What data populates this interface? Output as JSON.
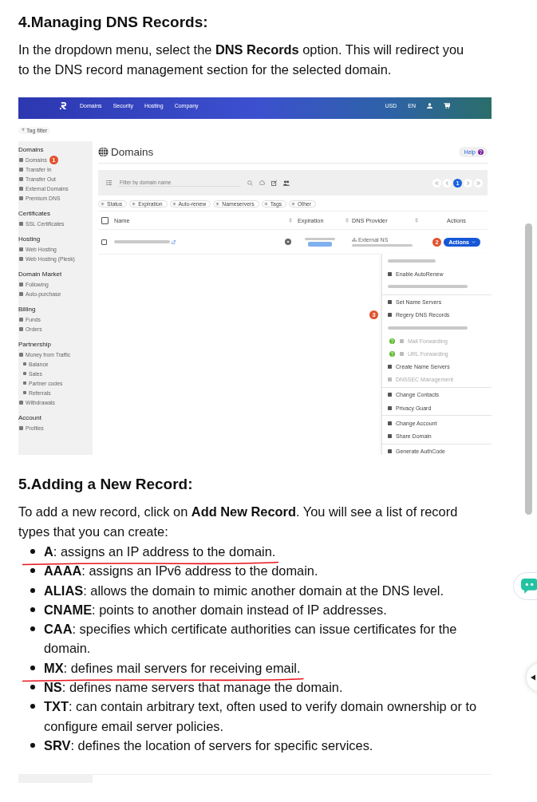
{
  "section_4": {
    "heading": "4.Managing DNS Records:",
    "paragraph": "In the dropdown menu, select the **DNS Records** option. This will redirect you to the DNS record management section for the selected domain."
  },
  "screenshot": {
    "nav": {
      "links": [
        "Domains",
        "Security",
        "Hosting",
        "Company"
      ],
      "currency": "USD",
      "language": "EN"
    },
    "tag_filter": "Tag filter",
    "sidebar": [
      {
        "heading": "Domains",
        "items": [
          {
            "label": "Domains",
            "badge": "1"
          },
          {
            "label": "Transfer In"
          },
          {
            "label": "Transfer Out"
          },
          {
            "label": "External Domains"
          },
          {
            "label": "Premium DNS"
          }
        ]
      },
      {
        "heading": "Certificates",
        "items": [
          {
            "label": "SSL Certificates"
          }
        ]
      },
      {
        "heading": "Hosting",
        "items": [
          {
            "label": "Web Hosting"
          },
          {
            "label": "Web Hosting (Plesk)"
          }
        ]
      },
      {
        "heading": "Domain Market",
        "items": [
          {
            "label": "Following"
          },
          {
            "label": "Auto-purchase"
          }
        ]
      },
      {
        "heading": "Billing",
        "items": [
          {
            "label": "Funds"
          },
          {
            "label": "Orders"
          }
        ]
      },
      {
        "heading": "Partnership",
        "items": [
          {
            "label": "Money from Traffic",
            "children": [
              {
                "label": "Balance"
              },
              {
                "label": "Sales"
              },
              {
                "label": "Partner codes"
              },
              {
                "label": "Referrals"
              }
            ]
          },
          {
            "label": "Withdrawals"
          }
        ]
      },
      {
        "heading": "Account",
        "items": [
          {
            "label": "Profiles"
          }
        ]
      }
    ],
    "title": "Domains",
    "help": "Help",
    "filter": {
      "placeholder": "Filter by domain name"
    },
    "pagination": [
      {
        "label": "1",
        "selected": true
      }
    ],
    "chips": [
      "Status",
      "Expiration",
      "Auto-renew",
      "Nameservers",
      "Tags",
      "Other"
    ],
    "columns": [
      "Name",
      "Expiration",
      "DNS Provider",
      "Actions"
    ],
    "select_all": {
      "checked": false
    },
    "row": {
      "checked": false,
      "provider": "External NS",
      "badge": "2",
      "action": "Actions"
    },
    "menu_groups": [
      [
        {
          "kind": "blurred"
        },
        {
          "kind": "item",
          "label": "Enable AutoRenew",
          "disabled": false,
          "help": false
        },
        {
          "kind": "blurred"
        }
      ],
      [
        {
          "kind": "item",
          "label": "Set Name Servers",
          "disabled": false,
          "help": false
        },
        {
          "kind": "item",
          "label": "Regery DNS Records",
          "disabled": false,
          "help": false,
          "badge": "3"
        },
        {
          "kind": "blurred"
        },
        {
          "kind": "item",
          "label": "Mail Forwarding",
          "disabled": true,
          "help": true
        },
        {
          "kind": "item",
          "label": "URL Forwarding",
          "disabled": true,
          "help": true
        },
        {
          "kind": "item",
          "label": "Create Name Servers",
          "disabled": false,
          "help": false
        },
        {
          "kind": "item",
          "label": "DNSSEC Management",
          "disabled": true,
          "help": false
        }
      ],
      [
        {
          "kind": "item",
          "label": "Change Contacts",
          "disabled": false,
          "help": false
        },
        {
          "kind": "item",
          "label": "Privacy Guard",
          "disabled": false,
          "help": false
        }
      ],
      [
        {
          "kind": "item",
          "label": "Change Account",
          "disabled": false,
          "help": false
        },
        {
          "kind": "item",
          "label": "Share Domain",
          "disabled": false,
          "help": false
        }
      ],
      [
        {
          "kind": "item",
          "label": "Generate AuthCode",
          "disabled": false,
          "help": false
        }
      ]
    ]
  },
  "section_5": {
    "heading": "5.Adding a New Record:",
    "paragraph": "To add a new record, click on **Add New Record**. You will see a list of record types that you can create:",
    "items": [
      {
        "text": "**A**: assigns an IP address to the domain.",
        "underlined": true
      },
      {
        "text": "**AAAA**: assigns an IPv6 address to the domain.",
        "underlined": false
      },
      {
        "text": "**ALIAS**: allows the domain to mimic another domain at the DNS level.",
        "underlined": false
      },
      {
        "text": "**CNAME**: points to another domain instead of IP addresses.",
        "underlined": false
      },
      {
        "text": "**CAA**: specifies which certificate authorities can issue certificates for the domain.",
        "underlined": false
      },
      {
        "text": "**MX**: defines mail servers for receiving email.",
        "underlined": true
      },
      {
        "text": "**NS**: defines name servers that manage the domain.",
        "underlined": false
      },
      {
        "text": "**TXT**: can contain arbitrary text, often used to verify domain ownership or to configure email server policies.",
        "underlined": false
      },
      {
        "text": "**SRV**: defines the location of servers for specific services.",
        "underlined": false
      }
    ]
  }
}
